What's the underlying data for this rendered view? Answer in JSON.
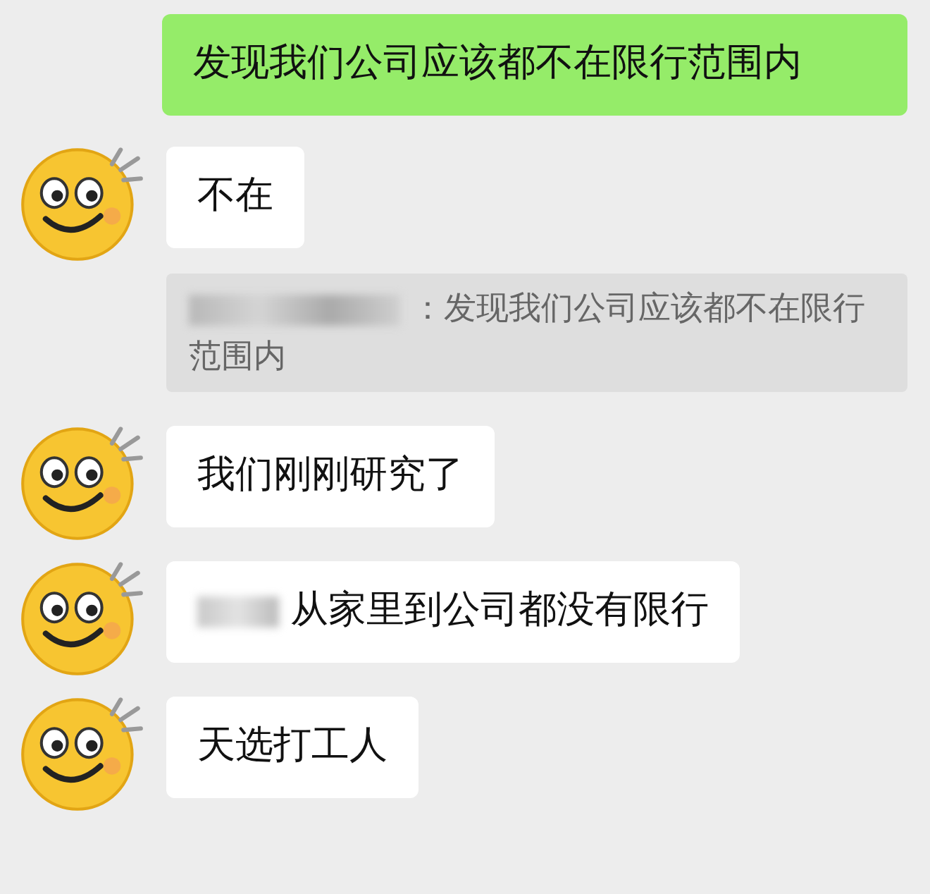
{
  "messages": [
    {
      "kind": "outgoing",
      "text": "发现我们公司应该都不在限行范围内",
      "blurred_prefix": false
    },
    {
      "kind": "incoming",
      "text": "不在",
      "blurred_prefix": false
    },
    {
      "kind": "quote",
      "text": "：发现我们公司应该都不在限行范围内",
      "blurred_prefix": true
    },
    {
      "kind": "incoming",
      "text": "我们刚刚研究了",
      "blurred_prefix": false
    },
    {
      "kind": "incoming",
      "text": "从家里到公司都没有限行",
      "blurred_prefix": true
    },
    {
      "kind": "incoming",
      "text": "天选打工人",
      "blurred_prefix": false
    }
  ]
}
